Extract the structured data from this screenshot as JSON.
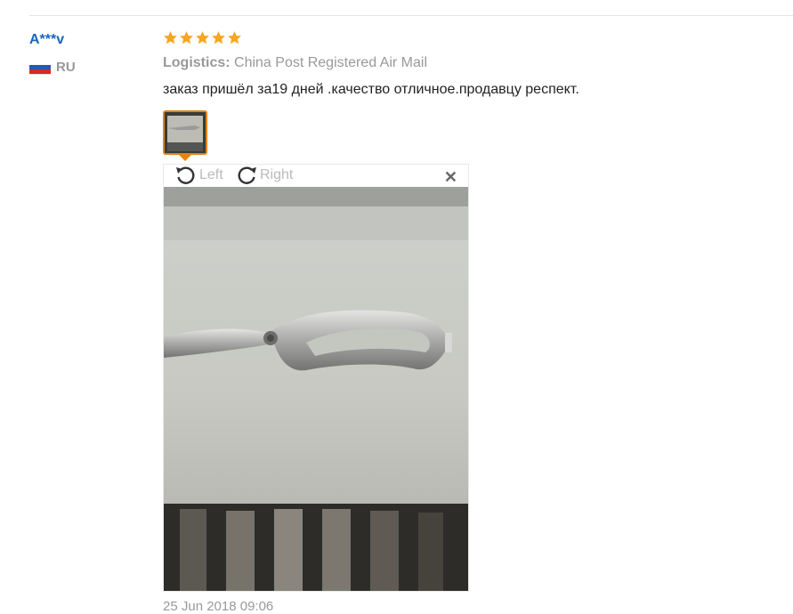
{
  "review": {
    "user_name": "A***v",
    "country_code": "RU",
    "rating": 5,
    "logistics_label": "Logistics:",
    "logistics_value": "China Post Registered Air Mail",
    "text": "заказ пришёл за19 дней .качество отличное.продавцу респект.",
    "date": "25 Jun 2018 09:06"
  },
  "viewer": {
    "rotate_left_label": "Left",
    "rotate_right_label": "Right",
    "close_icon": "close-icon",
    "photo_subject": "kitchen scissors"
  },
  "colors": {
    "user_link": "#1a66b8",
    "star": "#f5a623",
    "thumb_border": "#e6820e",
    "muted_text": "#999999"
  }
}
